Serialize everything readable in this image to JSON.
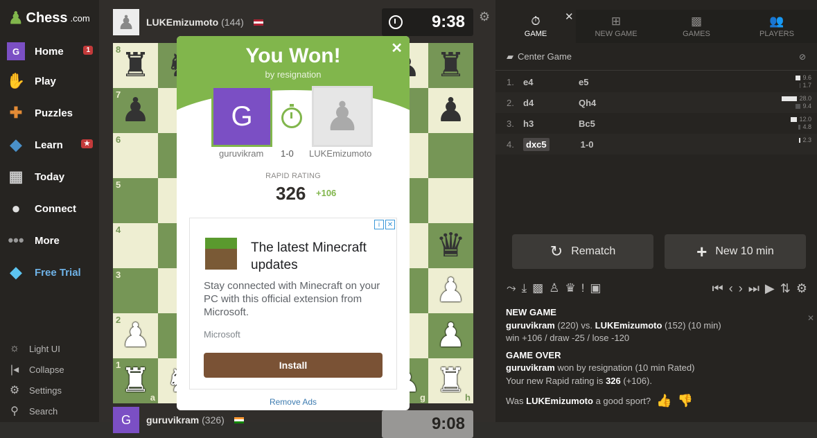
{
  "brand": {
    "name": "Chess",
    "suffix": ".com"
  },
  "sidebar": {
    "items": [
      {
        "label": "Home",
        "icon": "home-icon",
        "badge": "1"
      },
      {
        "label": "Play",
        "icon": "play-icon"
      },
      {
        "label": "Puzzles",
        "icon": "puzzle-icon"
      },
      {
        "label": "Learn",
        "icon": "learn-icon",
        "badge": "★"
      },
      {
        "label": "Today",
        "icon": "news-icon"
      },
      {
        "label": "Connect",
        "icon": "chat-icon"
      },
      {
        "label": "More",
        "icon": "more-icon"
      },
      {
        "label": "Free Trial",
        "icon": "diamond-icon"
      }
    ],
    "bottom": [
      {
        "label": "Light UI",
        "icon": "sun-icon"
      },
      {
        "label": "Collapse",
        "icon": "collapse-icon"
      },
      {
        "label": "Settings",
        "icon": "gear-icon"
      },
      {
        "label": "Search",
        "icon": "search-icon"
      }
    ],
    "avatar_letter": "G"
  },
  "top_player": {
    "name": "LUKEmizumoto",
    "rating": "(144)",
    "clock": "9:38"
  },
  "bottom_player": {
    "name": "guruvikram",
    "rating": "(326)",
    "clock": "9:08"
  },
  "board": {
    "ranks": [
      "8",
      "7",
      "6",
      "5",
      "4",
      "3",
      "2",
      "1"
    ],
    "files": [
      "a",
      "b",
      "c",
      "d",
      "e",
      "f",
      "g",
      "h"
    ],
    "rows": [
      [
        "br",
        "bn",
        "",
        "",
        "",
        "",
        "bp",
        "br"
      ],
      [
        "bp",
        "",
        "",
        "",
        "",
        "",
        "",
        "bp"
      ],
      [
        "",
        "",
        "",
        "",
        "",
        "",
        "",
        ""
      ],
      [
        "",
        "",
        "",
        "",
        "",
        "",
        "",
        ""
      ],
      [
        "",
        "",
        "",
        "",
        "",
        "",
        "",
        "bq"
      ],
      [
        "",
        "",
        "",
        "",
        "",
        "",
        "",
        "wp"
      ],
      [
        "wp",
        "",
        "",
        "",
        "",
        "",
        "",
        "wp"
      ],
      [
        "wr",
        "wn",
        "",
        "",
        "",
        "",
        "wp",
        "wr"
      ]
    ]
  },
  "modal": {
    "title": "You Won!",
    "subtitle": "by resignation",
    "winner": {
      "name": "guruvikram",
      "letter": "G"
    },
    "loser": {
      "name": "LUKEmizumoto"
    },
    "score": "1-0",
    "rating_label": "RAPID RATING",
    "rating": "326",
    "rating_delta": "+106",
    "ad": {
      "title": "The latest Minecraft updates",
      "description": "Stay connected with Minecraft on your PC with this official extension from Microsoft.",
      "brand": "Microsoft",
      "button": "Install"
    },
    "remove_ads": "Remove Ads"
  },
  "tabs": [
    {
      "label": "GAME",
      "icon": "clock-icon"
    },
    {
      "label": "NEW GAME",
      "icon": "plus-icon"
    },
    {
      "label": "GAMES",
      "icon": "board-icon"
    },
    {
      "label": "PLAYERS",
      "icon": "players-icon"
    }
  ],
  "opening": "Center Game",
  "moves": [
    {
      "n": "1.",
      "w": "e4",
      "b": "e5",
      "tw": "9.6",
      "tb": "1.7",
      "bw": 0.34,
      "bb": 0.06
    },
    {
      "n": "2.",
      "w": "d4",
      "b": "Qh4",
      "tw": "28.0",
      "tb": "9.4",
      "bw": 1.0,
      "bb": 0.34
    },
    {
      "n": "3.",
      "w": "h3",
      "b": "Bc5",
      "tw": "12.0",
      "tb": "4.8",
      "bw": 0.43,
      "bb": 0.17
    },
    {
      "n": "4.",
      "w": "dxc5",
      "b": "1-0",
      "tw": "2.3",
      "tb": "",
      "bw": 0.08,
      "bb": 0
    }
  ],
  "buttons": {
    "rematch": "Rematch",
    "new_game": "New 10 min"
  },
  "log": {
    "new_game_title": "NEW GAME",
    "p1": "guruvikram",
    "p1_rating": "(220) vs.",
    "p2": "LUKEmizumoto",
    "p2_rating": "(152) (10 min)",
    "outcomes": "win +106 / draw -25 / lose -120",
    "game_over_title": "GAME OVER",
    "winner": "guruvikram",
    "result": "won by resignation (10 min Rated)",
    "new_rating_prefix": "Your new Rapid rating is",
    "new_rating": "326",
    "new_rating_delta": "(+106).",
    "sport_prefix": "Was",
    "sport_name": "LUKEmizumoto",
    "sport_suffix": "a good sport?"
  }
}
